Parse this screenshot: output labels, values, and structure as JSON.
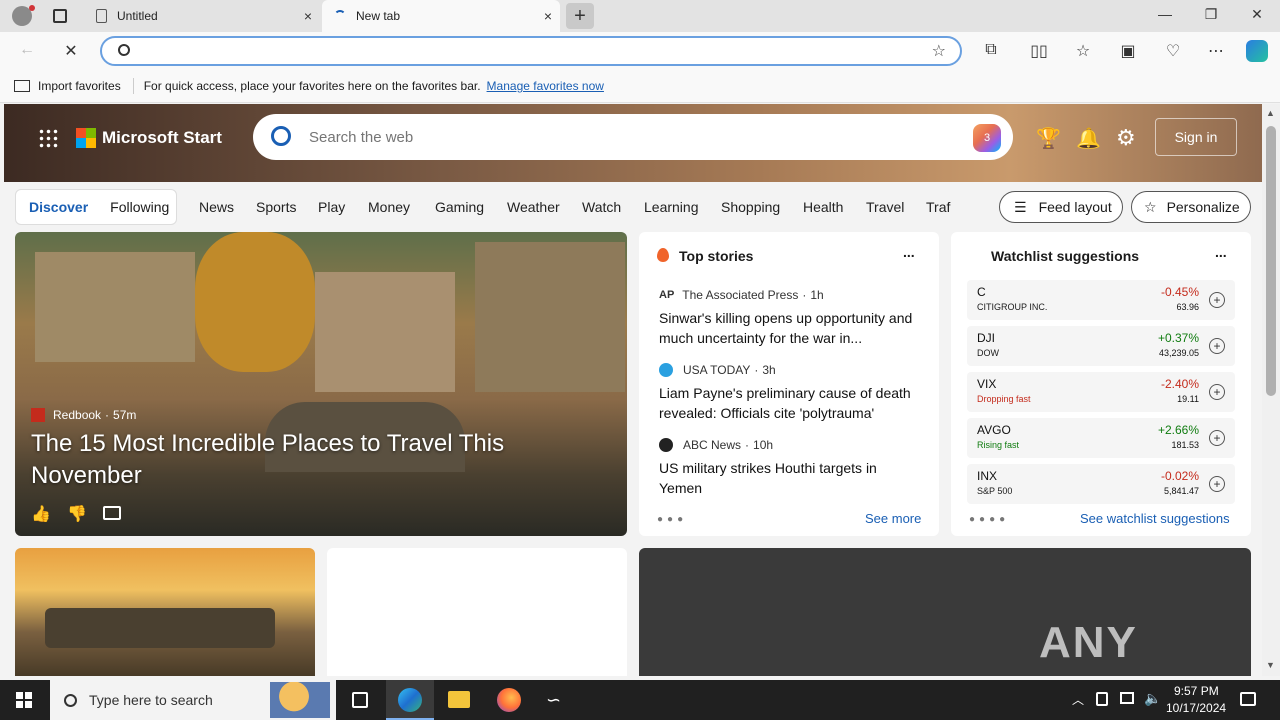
{
  "tabs": [
    {
      "title": "Untitled",
      "close": "×"
    },
    {
      "title": "New tab",
      "close": "×"
    }
  ],
  "new_tab_glyph": "+",
  "window_controls": {
    "minimize": "—",
    "restore": "❐",
    "close": "✕"
  },
  "address_bar": {
    "value": "",
    "placeholder": ""
  },
  "favorites_bar": {
    "import_label": "Import favorites",
    "message": "For quick access, place your favorites here on the favorites bar.",
    "manage_link": "Manage favorites now"
  },
  "header": {
    "brand": "Microsoft Start",
    "search_placeholder": "Search the web",
    "copilot_badge": "3",
    "sign_in": "Sign in"
  },
  "nav": {
    "pill": [
      "Discover",
      "Following"
    ],
    "items": [
      "News",
      "Sports",
      "Play",
      "Money",
      "Gaming",
      "Weather",
      "Watch",
      "Learning",
      "Shopping",
      "Health",
      "Travel",
      "Traf"
    ],
    "feed_layout": "Feed layout",
    "personalize": "Personalize"
  },
  "hero": {
    "source": "Redbook",
    "time": "57m",
    "title": "The 15 Most Incredible Places to Travel This November"
  },
  "top_stories": {
    "title": "Top stories",
    "more": "...",
    "items": [
      {
        "source": "The Associated Press",
        "time": "1h",
        "logo": "AP",
        "headline": "Sinwar's killing opens up opportunity and much uncertainty for the war in..."
      },
      {
        "source": "USA TODAY",
        "time": "3h",
        "logo": "",
        "headline": "Liam Payne's preliminary cause of death revealed: Officials cite 'polytrauma'"
      },
      {
        "source": "ABC News",
        "time": "10h",
        "logo": "",
        "headline": "US military strikes Houthi targets in Yemen"
      }
    ],
    "see_more": "See more"
  },
  "watchlist": {
    "title": "Watchlist suggestions",
    "more": "...",
    "items": [
      {
        "symbol": "C",
        "sub": "CITIGROUP INC.",
        "change": "-0.45%",
        "price": "63.96",
        "dir": "neg",
        "sub_kind": "name"
      },
      {
        "symbol": "DJI",
        "sub": "DOW",
        "change": "+0.37%",
        "price": "43,239.05",
        "dir": "pos",
        "sub_kind": "name"
      },
      {
        "symbol": "VIX",
        "sub": "Dropping fast",
        "change": "-2.40%",
        "price": "19.11",
        "dir": "neg",
        "sub_kind": "status"
      },
      {
        "symbol": "AVGO",
        "sub": "Rising fast",
        "change": "+2.66%",
        "price": "181.53",
        "dir": "pos",
        "sub_kind": "status"
      },
      {
        "symbol": "INX",
        "sub": "S&P 500",
        "change": "-0.02%",
        "price": "5,841.47",
        "dir": "neg",
        "sub_kind": "name"
      }
    ],
    "see_more": "See watchlist suggestions"
  },
  "watermark": "ANY RUN",
  "taskbar": {
    "search_placeholder": "Type here to search",
    "time": "9:57 PM",
    "date": "10/17/2024"
  },
  "colors": {
    "accent": "#1a5fb4",
    "negative": "#c42b1c",
    "positive": "#107c10"
  }
}
